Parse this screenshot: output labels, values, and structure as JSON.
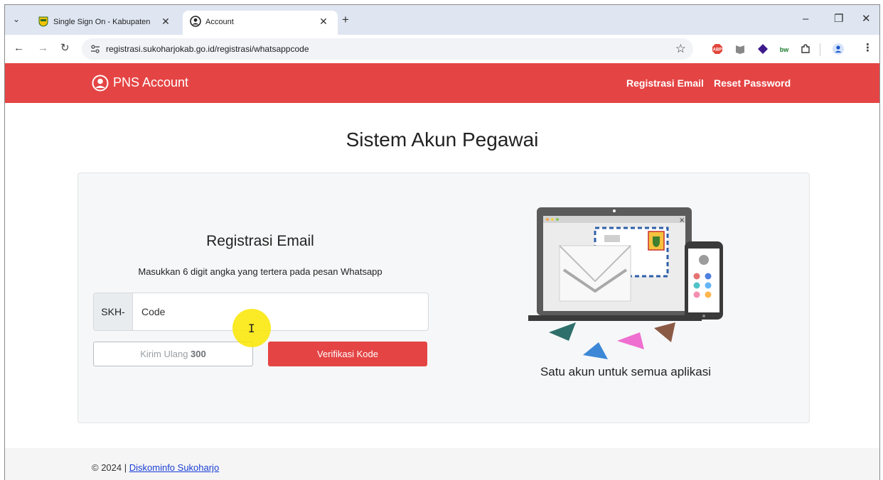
{
  "browser": {
    "tabs": [
      {
        "title": "Single Sign On - Kabupaten Su",
        "active": false
      },
      {
        "title": "Account",
        "active": true
      }
    ],
    "url": "registrasi.sukoharjokab.go.id/registrasi/whatsappcode",
    "extensions": [
      "abp-icon",
      "reader-icon",
      "diamond-icon",
      "bw-icon",
      "puzzle-icon",
      "profile-icon",
      "more-icon"
    ]
  },
  "header": {
    "brand": "PNS Account",
    "nav": {
      "registrasi_email": "Registrasi Email",
      "reset_password": "Reset Password"
    },
    "color": "#e54444"
  },
  "page": {
    "title": "Sistem Akun Pegawai"
  },
  "form": {
    "title": "Registrasi Email",
    "subtitle": "Masukkan 6 digit angka yang tertera pada pesan Whatsapp",
    "prefix": "SKH-",
    "code_placeholder": "Code",
    "code_value": "",
    "resend_label": "Kirim Ulang",
    "resend_countdown": "300",
    "verify_label": "Verifikasi Kode"
  },
  "aside": {
    "tagline": "Satu akun untuk semua aplikasi"
  },
  "footer": {
    "copyright": "© 2024 |",
    "link": "Diskominfo Sukoharjo"
  }
}
